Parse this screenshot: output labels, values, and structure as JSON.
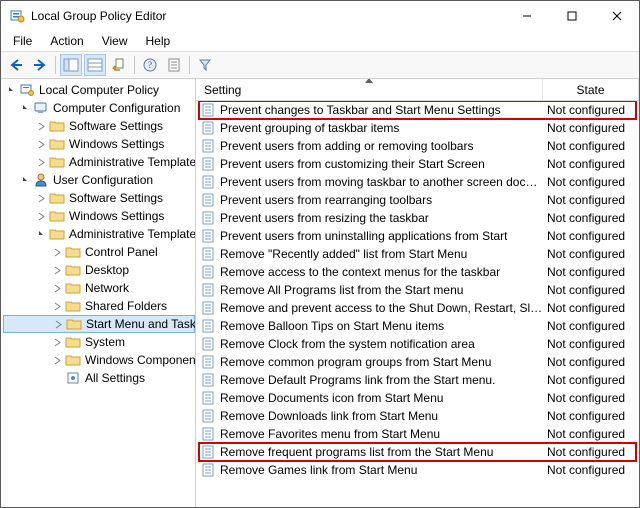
{
  "window": {
    "title": "Local Group Policy Editor"
  },
  "menubar": [
    "File",
    "Action",
    "View",
    "Help"
  ],
  "tree": {
    "root": "Local Computer Policy",
    "computer": {
      "label": "Computer Configuration",
      "children": [
        "Software Settings",
        "Windows Settings",
        "Administrative Templates"
      ]
    },
    "user": {
      "label": "User Configuration",
      "children": [
        "Software Settings",
        "Windows Settings"
      ],
      "admin": {
        "label": "Administrative Templates",
        "children": [
          "Control Panel",
          "Desktop",
          "Network",
          "Shared Folders",
          "Start Menu and Taskbar",
          "System",
          "Windows Components",
          "All Settings"
        ],
        "selectedIndex": 4
      }
    }
  },
  "list": {
    "columns": {
      "setting": "Setting",
      "state": "State"
    },
    "state_default": "Not configured",
    "rows": [
      {
        "s": "Prevent changes to Taskbar and Start Menu Settings",
        "hl": true
      },
      {
        "s": "Prevent grouping of taskbar items"
      },
      {
        "s": "Prevent users from adding or removing toolbars"
      },
      {
        "s": "Prevent users from customizing their Start Screen"
      },
      {
        "s": "Prevent users from moving taskbar to another screen dock l..."
      },
      {
        "s": "Prevent users from rearranging toolbars"
      },
      {
        "s": "Prevent users from resizing the taskbar"
      },
      {
        "s": "Prevent users from uninstalling applications from Start"
      },
      {
        "s": "Remove \"Recently added\" list from Start Menu"
      },
      {
        "s": "Remove access to the context menus for the taskbar"
      },
      {
        "s": "Remove All Programs list from the Start menu"
      },
      {
        "s": "Remove and prevent access to the Shut Down, Restart, Sleep..."
      },
      {
        "s": "Remove Balloon Tips on Start Menu items"
      },
      {
        "s": "Remove Clock from the system notification area"
      },
      {
        "s": "Remove common program groups from Start Menu"
      },
      {
        "s": "Remove Default Programs link from the Start menu."
      },
      {
        "s": "Remove Documents icon from Start Menu"
      },
      {
        "s": "Remove Downloads link from Start Menu"
      },
      {
        "s": "Remove Favorites menu from Start Menu"
      },
      {
        "s": "Remove frequent programs list from the Start Menu",
        "hl": true
      },
      {
        "s": "Remove Games link from Start Menu"
      }
    ]
  }
}
